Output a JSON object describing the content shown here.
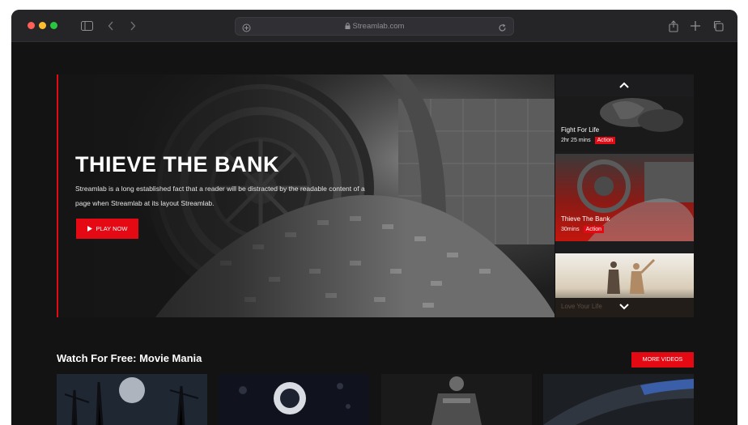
{
  "browser": {
    "url": "Streamlab.com"
  },
  "hero": {
    "title": "THIEVE THE BANK",
    "description": "Streamlab is a long established fact that a reader will be distracted by the readable content of a page when Streamlab at its layout Streamlab.",
    "play_label": "PLAY NOW"
  },
  "sidebar": {
    "items": [
      {
        "title": "Fight For Life",
        "duration": "2hr 25 mins",
        "genre": "Action"
      },
      {
        "title": "Thieve The Bank",
        "duration": "30mins",
        "genre": "Action"
      },
      {
        "title": "Love Your Life",
        "duration": "",
        "genre": ""
      }
    ]
  },
  "section": {
    "title": "Watch For Free: Movie Mania",
    "more_label": "MORE VIDEOS"
  },
  "colors": {
    "accent": "#e50914",
    "background": "#131313"
  }
}
